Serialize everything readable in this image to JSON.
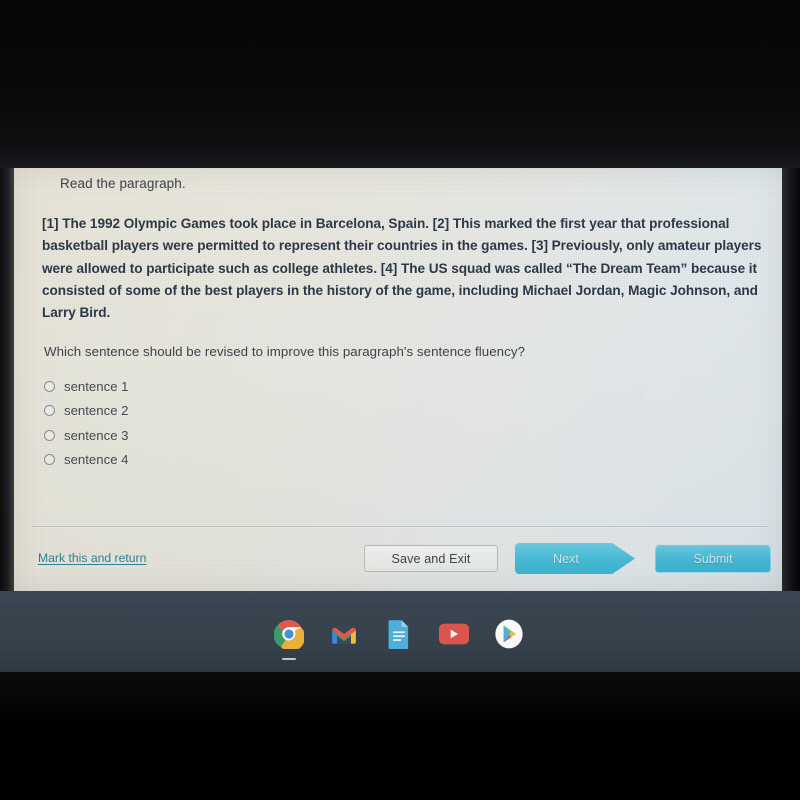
{
  "screen": {
    "background_color": "#000000",
    "content_background": "#ece7da"
  },
  "quiz": {
    "prompt": "Read the paragraph.",
    "paragraph": "[1] The 1992 Olympic Games took place in Barcelona, Spain. [2] This marked the first year that professional basketball players were permitted to represent their countries in the games. [3] Previously, only amateur players were allowed to participate such as college athletes.  [4] The US squad was called “The Dream Team” because it consisted of some of the best players in the history of the game, including Michael Jordan, Magic Johnson, and Larry Bird.",
    "question": "Which sentence should be revised to improve this paragraph's sentence fluency?",
    "choices": [
      {
        "label": "sentence 1",
        "selected": false
      },
      {
        "label": "sentence 2",
        "selected": false
      },
      {
        "label": "sentence 3",
        "selected": false
      },
      {
        "label": "sentence 4",
        "selected": false
      }
    ]
  },
  "footer": {
    "mark_and_return_label": "Mark this and return",
    "save_and_exit_label": "Save and Exit",
    "next_label": "Next",
    "submit_label": "Submit",
    "link_color": "#2f7f96",
    "accent_color": "#47bdd8"
  },
  "taskbar": {
    "background_color": "#3a4651",
    "icons": [
      {
        "name": "chrome-icon",
        "title": "Google Chrome",
        "active": true
      },
      {
        "name": "gmail-icon",
        "title": "Gmail",
        "active": false
      },
      {
        "name": "google-docs-icon",
        "title": "Google Docs",
        "active": false
      },
      {
        "name": "youtube-icon",
        "title": "YouTube",
        "active": false
      },
      {
        "name": "play-store-icon",
        "title": "Google Play Store",
        "active": false
      }
    ]
  }
}
